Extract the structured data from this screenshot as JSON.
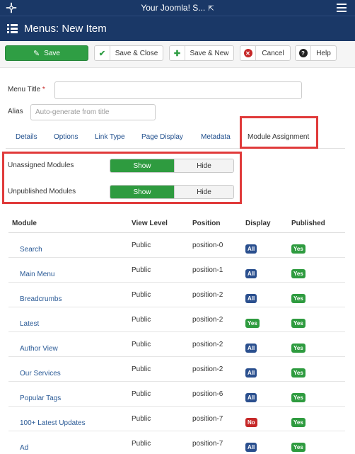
{
  "topbar": {
    "site_title": "Your Joomla! S...",
    "external_icon": "external-link-icon",
    "menu_icon": "hamburger-icon"
  },
  "titlebar": {
    "icon": "list-icon",
    "title": "Menus: New Item"
  },
  "toolbar": {
    "save": {
      "label": "Save",
      "icon": "edit-icon"
    },
    "save_close": {
      "label": "Save & Close",
      "icon": "check-icon"
    },
    "save_new": {
      "label": "Save & New",
      "icon": "plus-icon"
    },
    "cancel": {
      "label": "Cancel",
      "icon": "cancel-icon"
    },
    "help": {
      "label": "Help",
      "icon": "question-icon"
    }
  },
  "form": {
    "menu_title_label": "Menu Title",
    "menu_title_required": "*",
    "menu_title_value": "",
    "alias_label": "Alias",
    "alias_placeholder": "Auto-generate from title"
  },
  "tabs": [
    "Details",
    "Options",
    "Link Type",
    "Page Display",
    "Metadata",
    "Module Assignment"
  ],
  "active_tab": "Module Assignment",
  "filters": {
    "unassigned_label": "Unassigned Modules",
    "unpublished_label": "Unpublished Modules",
    "show_label": "Show",
    "hide_label": "Hide",
    "unassigned_value": "Show",
    "unpublished_value": "Show"
  },
  "table": {
    "headers": [
      "Module",
      "View Level",
      "Position",
      "Display",
      "Published"
    ],
    "rows": [
      {
        "module": "Search",
        "view_level": "Public",
        "position": "position-0",
        "display": "All",
        "published": "Yes"
      },
      {
        "module": "Main Menu",
        "view_level": "Public",
        "position": "position-1",
        "display": "All",
        "published": "Yes"
      },
      {
        "module": "Breadcrumbs",
        "view_level": "Public",
        "position": "position-2",
        "display": "All",
        "published": "Yes"
      },
      {
        "module": "Latest",
        "view_level": "Public",
        "position": "position-2",
        "display": "Yes",
        "published": "Yes"
      },
      {
        "module": "Author View",
        "view_level": "Public",
        "position": "position-2",
        "display": "All",
        "published": "Yes"
      },
      {
        "module": "Our Services",
        "view_level": "Public",
        "position": "position-2",
        "display": "All",
        "published": "Yes"
      },
      {
        "module": "Popular Tags",
        "view_level": "Public",
        "position": "position-6",
        "display": "All",
        "published": "Yes"
      },
      {
        "module": "100+ Latest Updates",
        "view_level": "Public",
        "position": "position-7",
        "display": "No",
        "published": "Yes"
      },
      {
        "module": "Ad",
        "view_level": "Public",
        "position": "position-7",
        "display": "All",
        "published": "Yes"
      }
    ]
  },
  "colors": {
    "header_bg": "#1a3867",
    "save_green": "#2f9e44",
    "highlight_red": "#e03a3a",
    "badge_blue": "#2a4f8e",
    "badge_green": "#2e9b3f",
    "badge_red": "#c62828"
  }
}
